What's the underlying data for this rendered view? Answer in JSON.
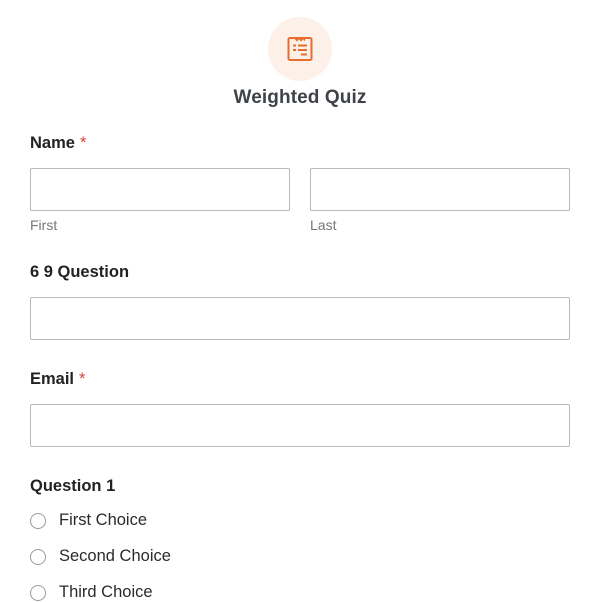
{
  "form": {
    "icon": "form-list-icon",
    "title": "Weighted Quiz",
    "accent_color": "#e66d2e",
    "icon_bg_color": "#fdf0e8",
    "required_color": "#d8433c"
  },
  "fields": {
    "name": {
      "label": "Name",
      "required_mark": "*",
      "first": {
        "value": "",
        "sublabel": "First"
      },
      "last": {
        "value": "",
        "sublabel": "Last"
      }
    },
    "question_69": {
      "label": "6 9 Question",
      "value": ""
    },
    "email": {
      "label": "Email",
      "required_mark": "*",
      "value": ""
    },
    "question_1": {
      "label": "Question 1",
      "choices": [
        {
          "label": "First Choice",
          "selected": false
        },
        {
          "label": "Second Choice",
          "selected": false
        },
        {
          "label": "Third Choice",
          "selected": false
        }
      ]
    }
  }
}
